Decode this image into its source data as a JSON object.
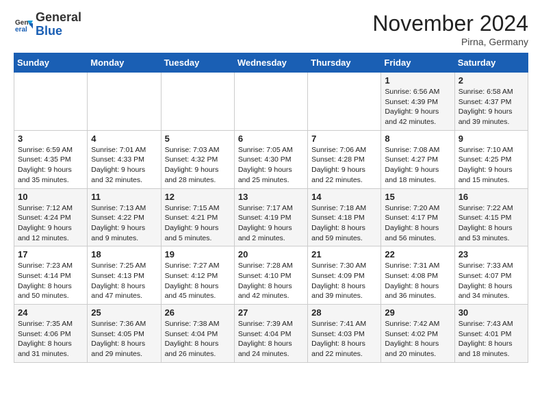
{
  "logo": {
    "general": "General",
    "blue": "Blue"
  },
  "title": "November 2024",
  "location": "Pirna, Germany",
  "days_of_week": [
    "Sunday",
    "Monday",
    "Tuesday",
    "Wednesday",
    "Thursday",
    "Friday",
    "Saturday"
  ],
  "weeks": [
    [
      {
        "day": "",
        "info": ""
      },
      {
        "day": "",
        "info": ""
      },
      {
        "day": "",
        "info": ""
      },
      {
        "day": "",
        "info": ""
      },
      {
        "day": "",
        "info": ""
      },
      {
        "day": "1",
        "info": "Sunrise: 6:56 AM\nSunset: 4:39 PM\nDaylight: 9 hours\nand 42 minutes."
      },
      {
        "day": "2",
        "info": "Sunrise: 6:58 AM\nSunset: 4:37 PM\nDaylight: 9 hours\nand 39 minutes."
      }
    ],
    [
      {
        "day": "3",
        "info": "Sunrise: 6:59 AM\nSunset: 4:35 PM\nDaylight: 9 hours\nand 35 minutes."
      },
      {
        "day": "4",
        "info": "Sunrise: 7:01 AM\nSunset: 4:33 PM\nDaylight: 9 hours\nand 32 minutes."
      },
      {
        "day": "5",
        "info": "Sunrise: 7:03 AM\nSunset: 4:32 PM\nDaylight: 9 hours\nand 28 minutes."
      },
      {
        "day": "6",
        "info": "Sunrise: 7:05 AM\nSunset: 4:30 PM\nDaylight: 9 hours\nand 25 minutes."
      },
      {
        "day": "7",
        "info": "Sunrise: 7:06 AM\nSunset: 4:28 PM\nDaylight: 9 hours\nand 22 minutes."
      },
      {
        "day": "8",
        "info": "Sunrise: 7:08 AM\nSunset: 4:27 PM\nDaylight: 9 hours\nand 18 minutes."
      },
      {
        "day": "9",
        "info": "Sunrise: 7:10 AM\nSunset: 4:25 PM\nDaylight: 9 hours\nand 15 minutes."
      }
    ],
    [
      {
        "day": "10",
        "info": "Sunrise: 7:12 AM\nSunset: 4:24 PM\nDaylight: 9 hours\nand 12 minutes."
      },
      {
        "day": "11",
        "info": "Sunrise: 7:13 AM\nSunset: 4:22 PM\nDaylight: 9 hours\nand 9 minutes."
      },
      {
        "day": "12",
        "info": "Sunrise: 7:15 AM\nSunset: 4:21 PM\nDaylight: 9 hours\nand 5 minutes."
      },
      {
        "day": "13",
        "info": "Sunrise: 7:17 AM\nSunset: 4:19 PM\nDaylight: 9 hours\nand 2 minutes."
      },
      {
        "day": "14",
        "info": "Sunrise: 7:18 AM\nSunset: 4:18 PM\nDaylight: 8 hours\nand 59 minutes."
      },
      {
        "day": "15",
        "info": "Sunrise: 7:20 AM\nSunset: 4:17 PM\nDaylight: 8 hours\nand 56 minutes."
      },
      {
        "day": "16",
        "info": "Sunrise: 7:22 AM\nSunset: 4:15 PM\nDaylight: 8 hours\nand 53 minutes."
      }
    ],
    [
      {
        "day": "17",
        "info": "Sunrise: 7:23 AM\nSunset: 4:14 PM\nDaylight: 8 hours\nand 50 minutes."
      },
      {
        "day": "18",
        "info": "Sunrise: 7:25 AM\nSunset: 4:13 PM\nDaylight: 8 hours\nand 47 minutes."
      },
      {
        "day": "19",
        "info": "Sunrise: 7:27 AM\nSunset: 4:12 PM\nDaylight: 8 hours\nand 45 minutes."
      },
      {
        "day": "20",
        "info": "Sunrise: 7:28 AM\nSunset: 4:10 PM\nDaylight: 8 hours\nand 42 minutes."
      },
      {
        "day": "21",
        "info": "Sunrise: 7:30 AM\nSunset: 4:09 PM\nDaylight: 8 hours\nand 39 minutes."
      },
      {
        "day": "22",
        "info": "Sunrise: 7:31 AM\nSunset: 4:08 PM\nDaylight: 8 hours\nand 36 minutes."
      },
      {
        "day": "23",
        "info": "Sunrise: 7:33 AM\nSunset: 4:07 PM\nDaylight: 8 hours\nand 34 minutes."
      }
    ],
    [
      {
        "day": "24",
        "info": "Sunrise: 7:35 AM\nSunset: 4:06 PM\nDaylight: 8 hours\nand 31 minutes."
      },
      {
        "day": "25",
        "info": "Sunrise: 7:36 AM\nSunset: 4:05 PM\nDaylight: 8 hours\nand 29 minutes."
      },
      {
        "day": "26",
        "info": "Sunrise: 7:38 AM\nSunset: 4:04 PM\nDaylight: 8 hours\nand 26 minutes."
      },
      {
        "day": "27",
        "info": "Sunrise: 7:39 AM\nSunset: 4:04 PM\nDaylight: 8 hours\nand 24 minutes."
      },
      {
        "day": "28",
        "info": "Sunrise: 7:41 AM\nSunset: 4:03 PM\nDaylight: 8 hours\nand 22 minutes."
      },
      {
        "day": "29",
        "info": "Sunrise: 7:42 AM\nSunset: 4:02 PM\nDaylight: 8 hours\nand 20 minutes."
      },
      {
        "day": "30",
        "info": "Sunrise: 7:43 AM\nSunset: 4:01 PM\nDaylight: 8 hours\nand 18 minutes."
      }
    ]
  ]
}
